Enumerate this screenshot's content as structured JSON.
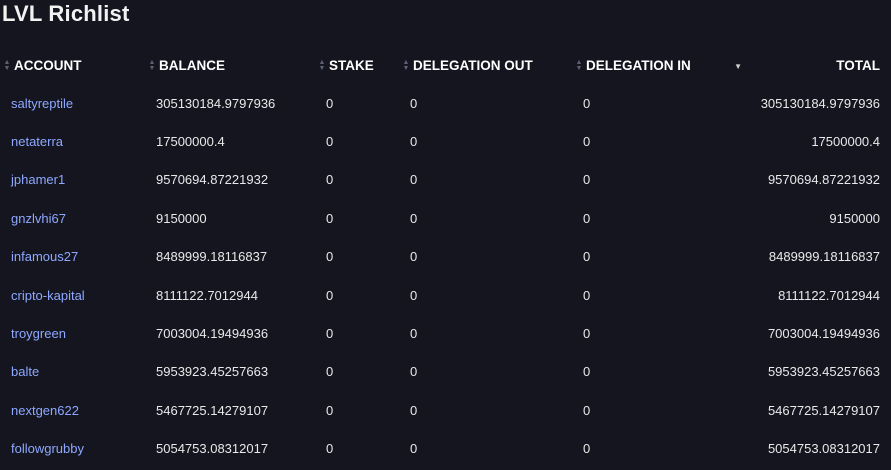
{
  "title": "LVL Richlist",
  "columns": {
    "account": "ACCOUNT",
    "balance": "BALANCE",
    "stake": "STAKE",
    "delegation_out": "DELEGATION OUT",
    "delegation_in": "DELEGATION IN",
    "total": "TOTAL"
  },
  "rows": [
    {
      "account": "saltyreptile",
      "balance": "305130184.9797936",
      "stake": "0",
      "delegation_out": "0",
      "delegation_in": "0",
      "total": "305130184.9797936"
    },
    {
      "account": "netaterra",
      "balance": "17500000.4",
      "stake": "0",
      "delegation_out": "0",
      "delegation_in": "0",
      "total": "17500000.4"
    },
    {
      "account": "jphamer1",
      "balance": "9570694.87221932",
      "stake": "0",
      "delegation_out": "0",
      "delegation_in": "0",
      "total": "9570694.87221932"
    },
    {
      "account": "gnzlvhi67",
      "balance": "9150000",
      "stake": "0",
      "delegation_out": "0",
      "delegation_in": "0",
      "total": "9150000"
    },
    {
      "account": "infamous27",
      "balance": "8489999.18116837",
      "stake": "0",
      "delegation_out": "0",
      "delegation_in": "0",
      "total": "8489999.18116837"
    },
    {
      "account": "cripto-kapital",
      "balance": "8111122.7012944",
      "stake": "0",
      "delegation_out": "0",
      "delegation_in": "0",
      "total": "8111122.7012944"
    },
    {
      "account": "troygreen",
      "balance": "7003004.19494936",
      "stake": "0",
      "delegation_out": "0",
      "delegation_in": "0",
      "total": "7003004.19494936"
    },
    {
      "account": "balte",
      "balance": "5953923.45257663",
      "stake": "0",
      "delegation_out": "0",
      "delegation_in": "0",
      "total": "5953923.45257663"
    },
    {
      "account": "nextgen622",
      "balance": "5467725.14279107",
      "stake": "0",
      "delegation_out": "0",
      "delegation_in": "0",
      "total": "5467725.14279107"
    },
    {
      "account": "followgrubby",
      "balance": "5054753.08312017",
      "stake": "0",
      "delegation_out": "0",
      "delegation_in": "0",
      "total": "5054753.08312017"
    }
  ],
  "icons": {
    "sort_both": "sort-both-icon",
    "sort_desc": "sort-descending-icon"
  }
}
